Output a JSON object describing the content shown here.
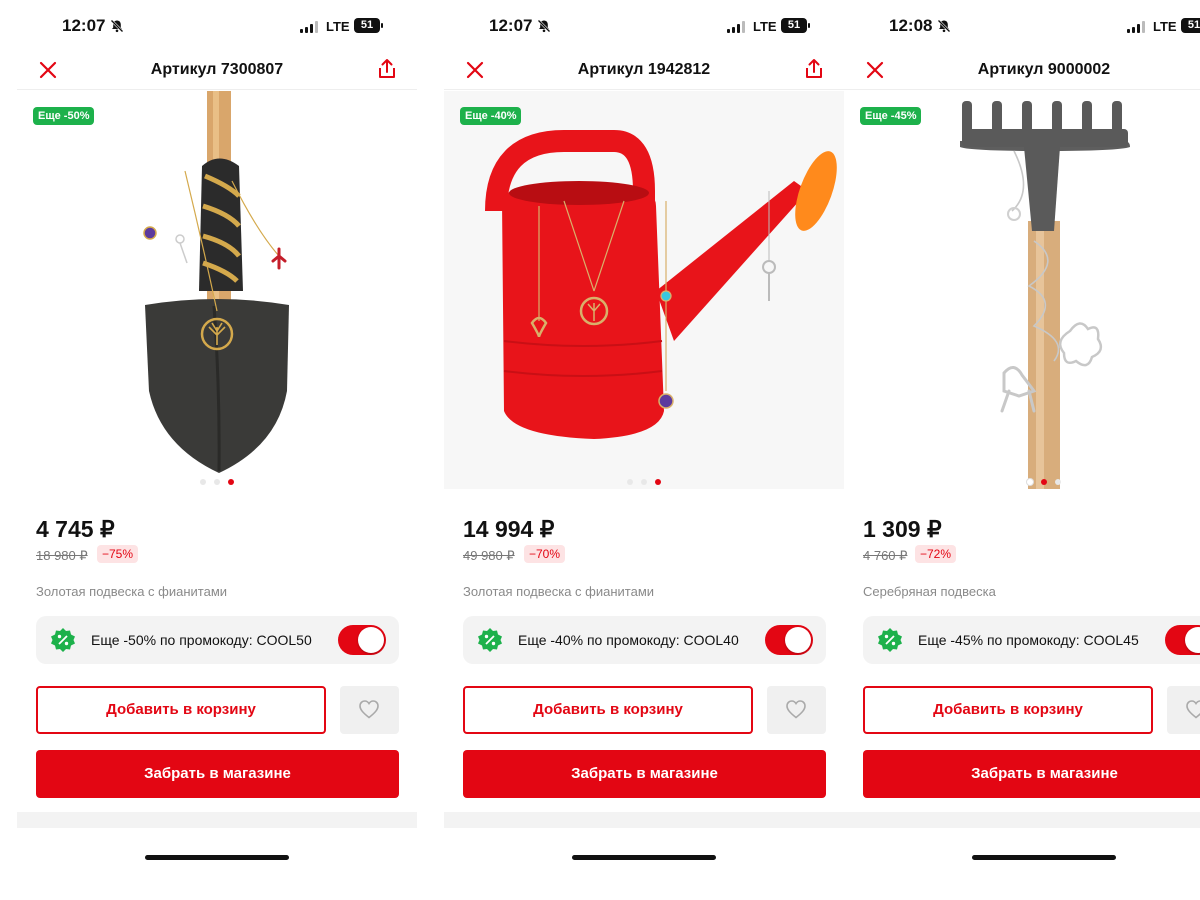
{
  "screens": [
    {
      "status": {
        "time": "12:07",
        "network": "LTE",
        "battery": "51"
      },
      "header": {
        "title": "Артикул 7300807"
      },
      "image": {
        "badge": "Еще -50%",
        "subject": "shovel with jewelry pendants",
        "slide_active": 3,
        "slide_count": 3
      },
      "price": "4 745 ₽",
      "old_price": "18 980 ₽",
      "discount": "−75%",
      "description": "Золотая подвеска с фианитами",
      "promo": {
        "text": "Еще -50% по промокоду: COOL50",
        "enabled": true
      },
      "add_to_cart": "Добавить в корзину",
      "pickup": "Забрать в магазине"
    },
    {
      "status": {
        "time": "12:07",
        "network": "LTE",
        "battery": "51"
      },
      "header": {
        "title": "Артикул 1942812"
      },
      "image": {
        "badge": "Еще -40%",
        "subject": "red watering can with jewelry pendants",
        "slide_active": 3,
        "slide_count": 3
      },
      "price": "14 994 ₽",
      "old_price": "49 980 ₽",
      "discount": "−70%",
      "description": "Золотая подвеска с фианитами",
      "promo": {
        "text": "Еще -40% по промокоду: COOL40",
        "enabled": true
      },
      "add_to_cart": "Добавить в корзину",
      "pickup": "Забрать в магазине"
    },
    {
      "status": {
        "time": "12:08",
        "network": "LTE",
        "battery": "51"
      },
      "header": {
        "title": "Артикул 9000002"
      },
      "image": {
        "badge": "Еще -45%",
        "subject": "rake with silver pendants",
        "slide_active": 2,
        "slide_count": 3
      },
      "price": "1 309 ₽",
      "old_price": "4 760 ₽",
      "discount": "−72%",
      "description": "Серебряная подвеска",
      "promo": {
        "text": "Еще -45% по промокоду: COOL45",
        "enabled": true
      },
      "add_to_cart": "Добавить в корзину",
      "pickup": "Забрать в магазине"
    }
  ],
  "icons": {
    "close": "close-icon",
    "share": "share-icon",
    "promo": "percent-badge-icon",
    "favorite": "heart-icon",
    "silent": "bell-slash-icon"
  },
  "colors": {
    "accent": "#e30613",
    "badge_green": "#1db14b",
    "discount_bg": "#fde3e4",
    "panel": "#f3f3f3"
  }
}
